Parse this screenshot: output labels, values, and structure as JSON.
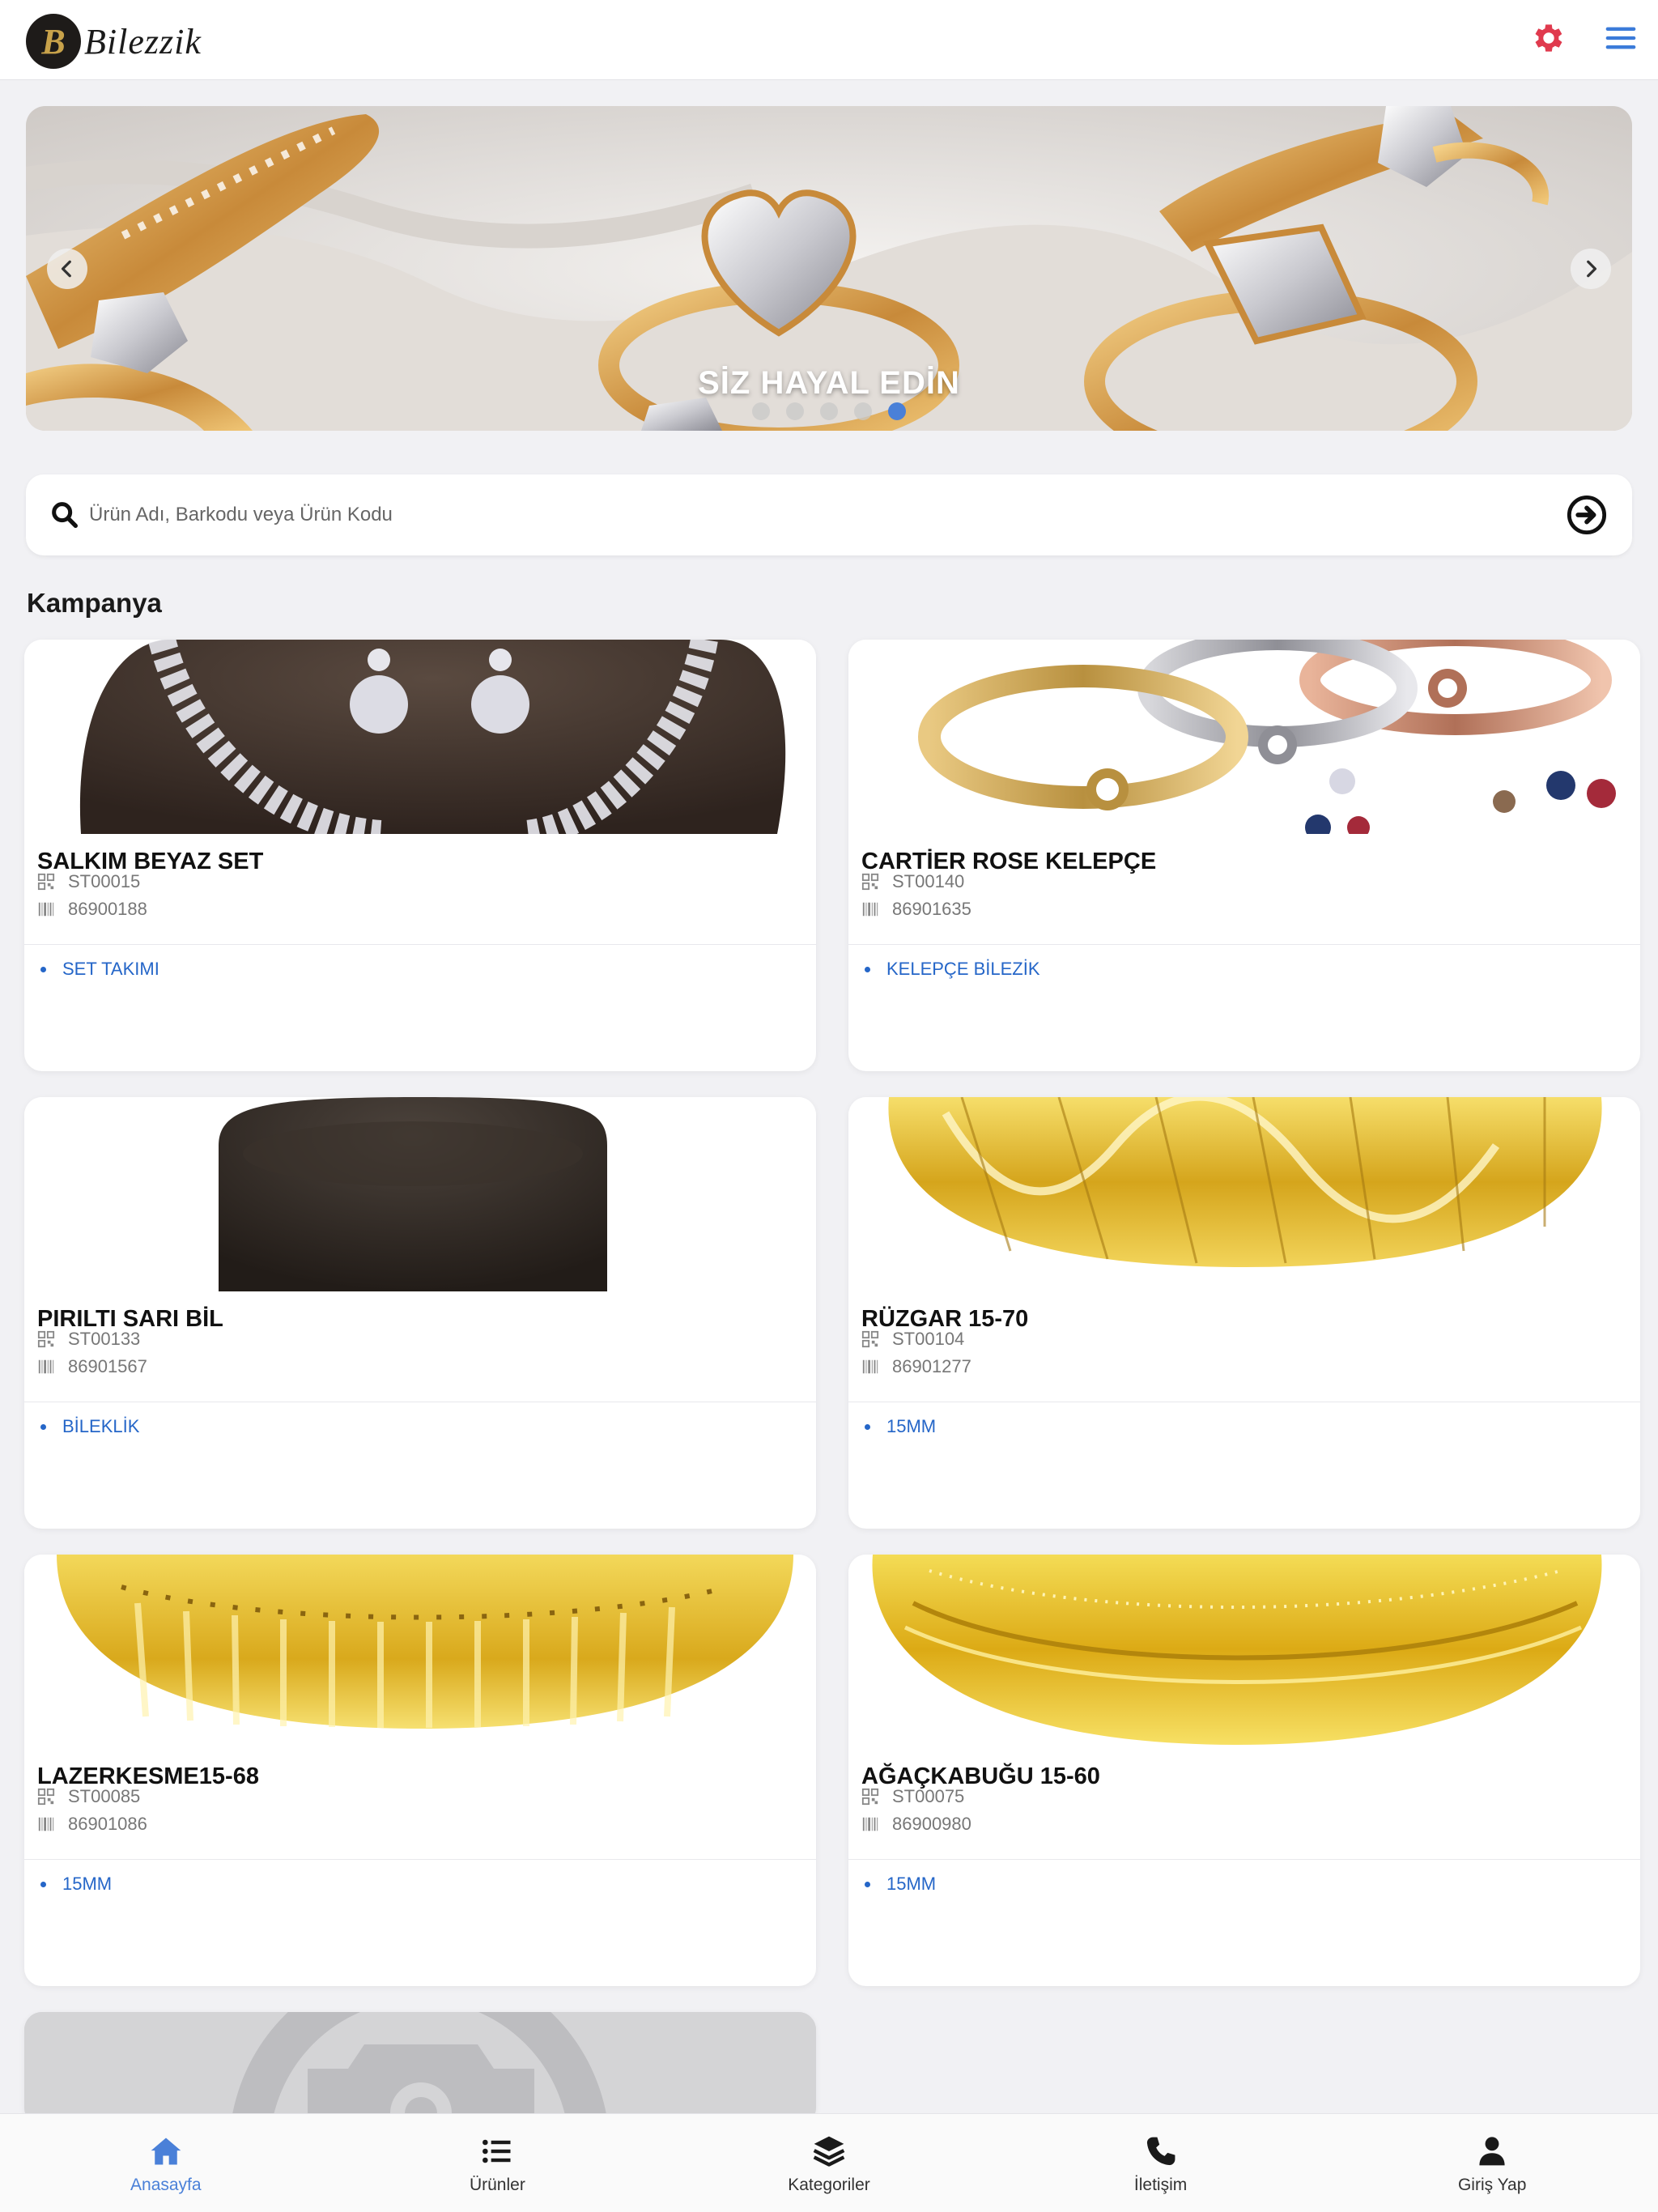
{
  "header": {
    "logo_text": "Bilezzik",
    "logo_mark": "B",
    "settings_icon": "gear-icon",
    "menu_icon": "hamburger-menu-icon",
    "accent_settings": "#e03a4e",
    "accent_menu": "#3b7bd9"
  },
  "banner": {
    "caption": "SİZ HAYAL EDİN",
    "slide_count": 5,
    "active_slide": 5,
    "prev_icon": "chevron-left-icon",
    "next_icon": "chevron-right-icon"
  },
  "search": {
    "placeholder": "Ürün Adı, Barkodu veya Ürün Kodu",
    "value": "",
    "search_icon": "search-icon",
    "submit_icon": "arrow-circle-right-icon"
  },
  "section": {
    "title": "Kampanya"
  },
  "products": [
    {
      "name": "SALKIM BEYAZ SET",
      "code": "ST00015",
      "barcode": "86900188",
      "category": "SET TAKIMI"
    },
    {
      "name": "CARTİER ROSE KELEPÇE",
      "code": "ST00140",
      "barcode": "86901635",
      "category": "KELEPÇE BİLEZİK"
    },
    {
      "name": "PIRILTI SARI BİL",
      "code": "ST00133",
      "barcode": "86901567",
      "category": "BİLEKLİK"
    },
    {
      "name": "RÜZGAR 15-70",
      "code": "ST00104",
      "barcode": "86901277",
      "category": "15MM"
    },
    {
      "name": "LAZERKESME15-68",
      "code": "ST00085",
      "barcode": "86901086",
      "category": "15MM"
    },
    {
      "name": "AĞAÇKABUĞU 15-60",
      "code": "ST00075",
      "barcode": "86900980",
      "category": "15MM"
    }
  ],
  "bottom_nav": [
    {
      "label": "Anasayfa",
      "icon": "home-icon",
      "active": true
    },
    {
      "label": "Ürünler",
      "icon": "list-icon",
      "active": false
    },
    {
      "label": "Kategoriler",
      "icon": "layers-icon",
      "active": false
    },
    {
      "label": "İletişim",
      "icon": "phone-icon",
      "active": false
    },
    {
      "label": "Giriş Yap",
      "icon": "user-icon",
      "active": false
    }
  ],
  "colors": {
    "background": "#f1f1f4",
    "link_blue": "#2566c8",
    "nav_active": "#4a80d8"
  }
}
